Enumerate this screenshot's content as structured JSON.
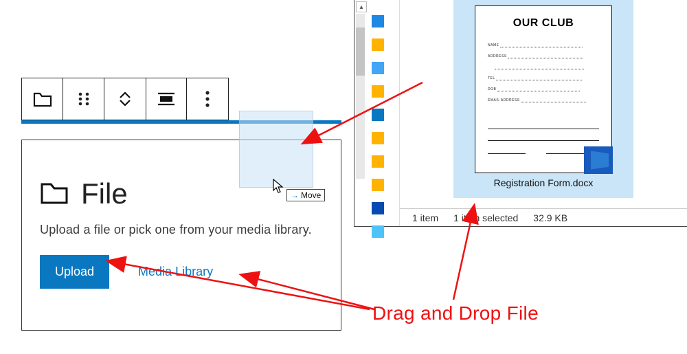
{
  "toolbar": {
    "icons": [
      "folder-icon",
      "drag-handle-icon",
      "move-updown-icon",
      "align-icon",
      "more-icon"
    ]
  },
  "file_block": {
    "title": "File",
    "description": "Upload a file or pick one from your media library.",
    "upload_label": "Upload",
    "media_library_label": "Media Library"
  },
  "drag": {
    "move_label": "Move"
  },
  "explorer": {
    "doc_title": "OUR CLUB",
    "form_labels": [
      "NAME",
      "ADDRESS",
      "TEL",
      "DOB",
      "EMAIL ADDRESS"
    ],
    "file_name": "Registration Form.docx",
    "status_items": "1 item",
    "status_selected": "1 item selected",
    "status_size": "32.9 KB"
  },
  "annotation": {
    "text": "Drag and Drop File",
    "color": "#e11"
  },
  "colors": {
    "accent": "#0a78c1",
    "word_blue": "#185abd",
    "selection_bg": "#c9e5f7",
    "annotation_red": "#e11"
  }
}
